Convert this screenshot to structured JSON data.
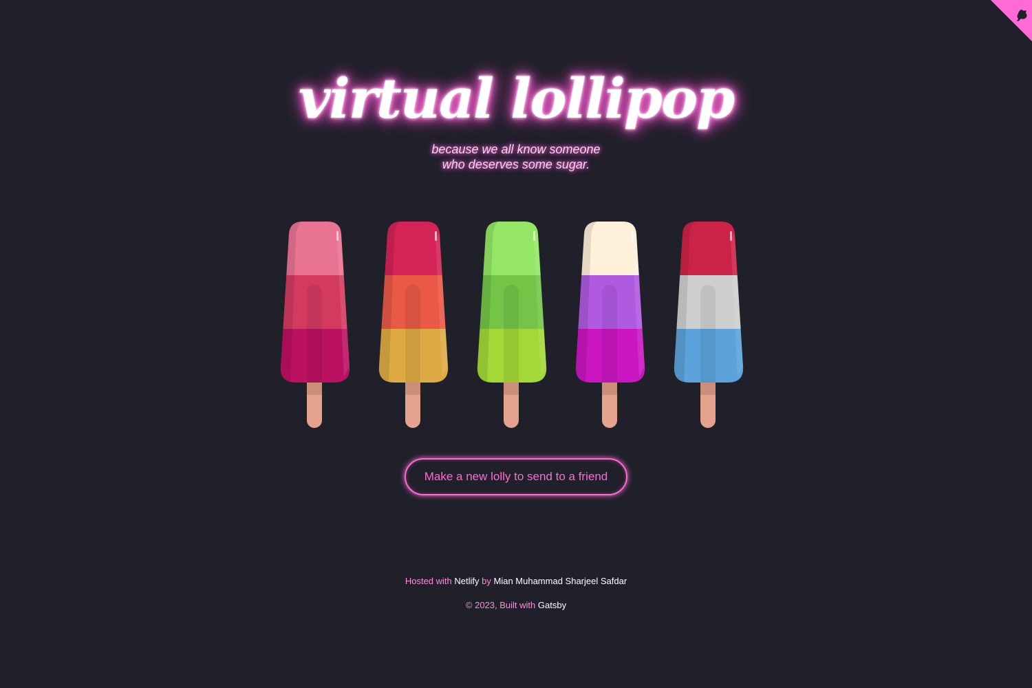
{
  "header": {
    "title": "virtual lollipop",
    "subtitle_line1": "because we all know someone",
    "subtitle_line2": "who deserves some sugar."
  },
  "github_corner": {
    "icon": "octocat-icon",
    "color": "#ff6ad5"
  },
  "lollies": [
    {
      "top": "#e97393",
      "middle": "#d23a60",
      "bottom": "#bb1161"
    },
    {
      "top": "#d52358",
      "middle": "#e95946",
      "bottom": "#deaa43"
    },
    {
      "top": "#96e665",
      "middle": "#74c447",
      "bottom": "#a3d837"
    },
    {
      "top": "#fff0da",
      "middle": "#b05ae0",
      "bottom": "#c916c0"
    },
    {
      "top": "#cd2247",
      "middle": "#d0cfcf",
      "bottom": "#5ba3da"
    }
  ],
  "cta": {
    "label": "Make a new lolly to send to a friend"
  },
  "footer": {
    "hosted_prefix": "Hosted with",
    "hosted_link": "Netlify",
    "by_text": "by",
    "author_link": "Mian Muhammad Sharjeel Safdar",
    "copyright_prefix": "© 2023, Built with",
    "built_link": "Gatsby"
  },
  "colors": {
    "background": "#20202a",
    "accent": "#ff6ad5",
    "stick": "#e5a38d"
  }
}
